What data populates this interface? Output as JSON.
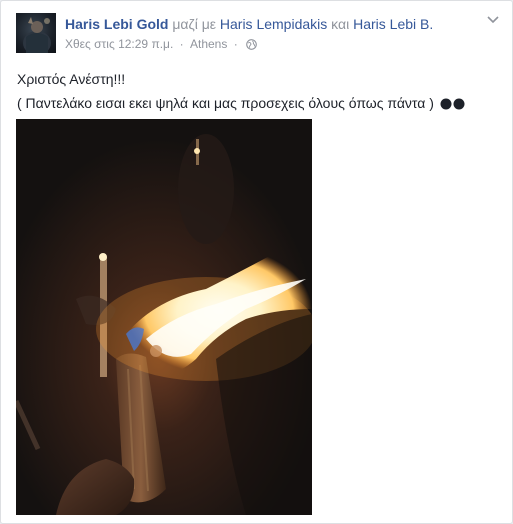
{
  "post": {
    "author": "Haris Lebi Gold",
    "with_text": "μαζί με",
    "tagged_1": "Haris Lempidakis",
    "and_text": "και",
    "tagged_2": "Haris Lebi B.",
    "timestamp": "Χθες στις 12:29 π.μ.",
    "separator": "·",
    "location": "Athens",
    "separator_2": "·",
    "privacy_icon": "globe-icon",
    "menu_icon": "chevron-down-icon",
    "line_1": "Χριστός Ανέστη!!!",
    "line_2": "( Παντελάκο εισαι εκει ψηλά και μας προσεχεις όλους όπως πάντα )"
  },
  "colors": {
    "link": "#365899",
    "meta": "#90949c",
    "text": "#1d2129",
    "card_border": "#dddfe2"
  }
}
